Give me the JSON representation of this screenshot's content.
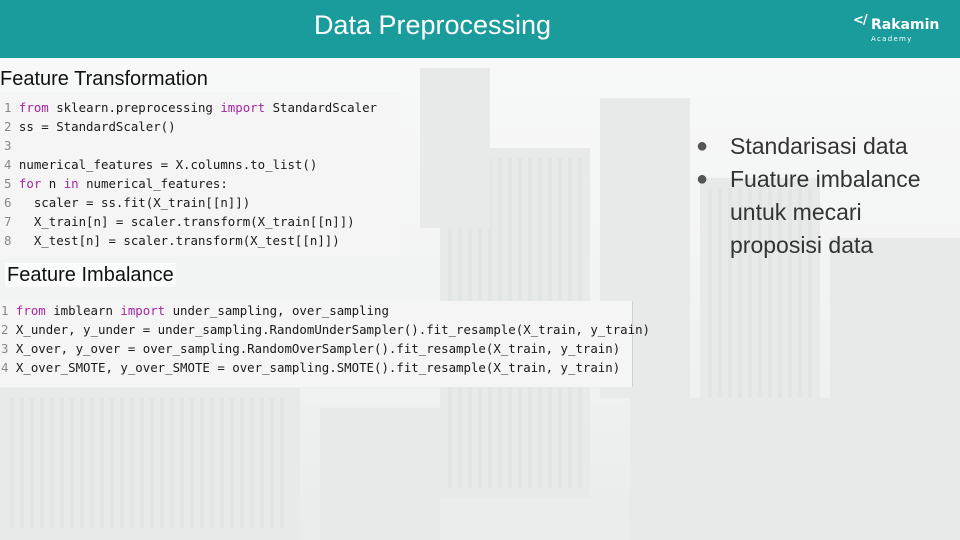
{
  "header": {
    "title": "Data Preprocessing",
    "logo_mark": "</",
    "logo_name": "Rakamin",
    "logo_sub": "Academy",
    "color": "#1a9c9c"
  },
  "sections": {
    "transformation_title": "Feature Transformation",
    "imbalance_title": "Feature Imbalance"
  },
  "code1": [
    {
      "n": "1",
      "parts": [
        {
          "t": "kw",
          "v": "from"
        },
        {
          "t": "",
          "v": " sklearn.preprocessing "
        },
        {
          "t": "kw",
          "v": "import"
        },
        {
          "t": "",
          "v": " StandardScaler"
        }
      ]
    },
    {
      "n": "2",
      "parts": [
        {
          "t": "",
          "v": "ss = StandardScaler()"
        }
      ]
    },
    {
      "n": "3",
      "parts": []
    },
    {
      "n": "4",
      "parts": [
        {
          "t": "",
          "v": "numerical_features = X.columns.to_list()"
        }
      ]
    },
    {
      "n": "5",
      "parts": [
        {
          "t": "kw",
          "v": "for"
        },
        {
          "t": "",
          "v": " n "
        },
        {
          "t": "kw",
          "v": "in"
        },
        {
          "t": "",
          "v": " numerical_features:"
        }
      ]
    },
    {
      "n": "6",
      "parts": [
        {
          "t": "",
          "v": "  scaler = ss.fit(X_train[[n]])"
        }
      ]
    },
    {
      "n": "7",
      "parts": [
        {
          "t": "",
          "v": "  X_train[n] = scaler.transform(X_train[[n]])"
        }
      ]
    },
    {
      "n": "8",
      "parts": [
        {
          "t": "",
          "v": "  X_test[n] = scaler.transform(X_test[[n]])"
        }
      ]
    }
  ],
  "code2": [
    {
      "n": "1",
      "parts": [
        {
          "t": "kw",
          "v": "from"
        },
        {
          "t": "",
          "v": " imblearn "
        },
        {
          "t": "kw",
          "v": "import"
        },
        {
          "t": "",
          "v": " under_sampling, over_sampling"
        }
      ]
    },
    {
      "n": "2",
      "parts": [
        {
          "t": "",
          "v": "X_under, y_under = under_sampling.RandomUnderSampler().fit_resample(X_train, y_train)"
        }
      ]
    },
    {
      "n": "3",
      "parts": [
        {
          "t": "",
          "v": "X_over, y_over = over_sampling.RandomOverSampler().fit_resample(X_train, y_train)"
        }
      ]
    },
    {
      "n": "4",
      "parts": [
        {
          "t": "",
          "v": "X_over_SMOTE, y_over_SMOTE = over_sampling.SMOTE().fit_resample(X_train, y_train)"
        }
      ]
    }
  ],
  "bullets": [
    "Standarisasi data",
    "Fuature imbalance untuk mecari proposisi data"
  ]
}
